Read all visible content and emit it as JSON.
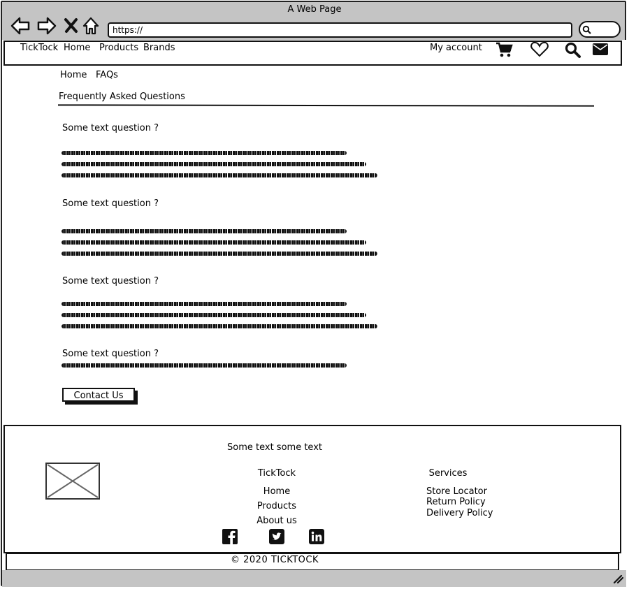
{
  "window": {
    "title": "A Web Page"
  },
  "address_bar": {
    "url": "https://"
  },
  "top_nav": {
    "brand": "TickTock",
    "links": [
      "Home",
      "Products",
      "Brands"
    ],
    "account": "My account",
    "icons": [
      "cart-icon",
      "heart-icon",
      "search-icon",
      "mail-icon"
    ]
  },
  "breadcrumb": [
    "Home",
    "FAQs"
  ],
  "page": {
    "title": "Frequently Asked Questions",
    "faqs": [
      {
        "question": "Some text question  ?"
      },
      {
        "question": "Some text question  ?"
      },
      {
        "question": "Some text question  ?"
      },
      {
        "question": "Some text question  ?"
      }
    ],
    "contact_button": "Contact Us"
  },
  "footer": {
    "tagline": "Some text some text",
    "col1": {
      "heading": "TickTock",
      "links": [
        "Home",
        "Products",
        "About us"
      ]
    },
    "col2": {
      "heading": "Services",
      "links": [
        "Store Locator",
        "Return Policy",
        "Delivery Policy"
      ]
    },
    "social_icons": [
      "facebook-icon",
      "twitter-icon",
      "linkedin-icon"
    ],
    "copyright": "© 2020 TICKTOCK"
  }
}
